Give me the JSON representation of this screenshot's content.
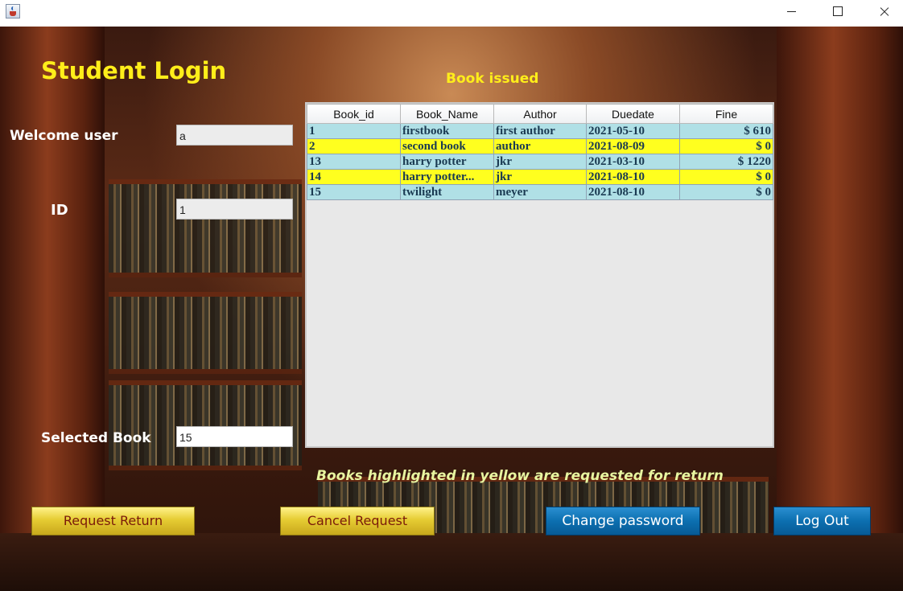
{
  "window": {
    "title": ""
  },
  "header": {
    "title": "Student Login",
    "table_title": "Book issued"
  },
  "form": {
    "welcome_label": "Welcome user",
    "welcome_value": "a",
    "id_label": "ID",
    "id_value": "1",
    "selected_label": "Selected Book",
    "selected_value": "15"
  },
  "table": {
    "columns": [
      "Book_id",
      "Book_Name",
      "Author",
      "Duedate",
      "Fine"
    ],
    "rows": [
      {
        "id": "1",
        "name": "firstbook",
        "author": "first author",
        "due": "2021-05-10",
        "fine": "$ 610",
        "highlight": "blue"
      },
      {
        "id": "2",
        "name": "second book",
        "author": "author",
        "due": "2021-08-09",
        "fine": "$ 0",
        "highlight": "yellow"
      },
      {
        "id": "13",
        "name": "harry potter",
        "author": "jkr",
        "due": "2021-03-10",
        "fine": "$ 1220",
        "highlight": "blue"
      },
      {
        "id": "14",
        "name": "harry potter...",
        "author": "jkr",
        "due": "2021-08-10",
        "fine": "$ 0",
        "highlight": "yellow"
      },
      {
        "id": "15",
        "name": "twilight",
        "author": "meyer",
        "due": "2021-08-10",
        "fine": "$ 0",
        "highlight": "blue"
      }
    ]
  },
  "note": "Books highlighted in yellow are requested for return",
  "buttons": {
    "request_return": "Request Return",
    "cancel_request": "Cancel  Request",
    "change_password": "Change password",
    "log_out": "Log Out"
  },
  "colors": {
    "heading": "#ffee1a",
    "row_blue": "#b0e0e6",
    "row_yellow": "#ffff1f",
    "button_blue": "#0c6fb0",
    "button_gold": "#e6cc33"
  }
}
